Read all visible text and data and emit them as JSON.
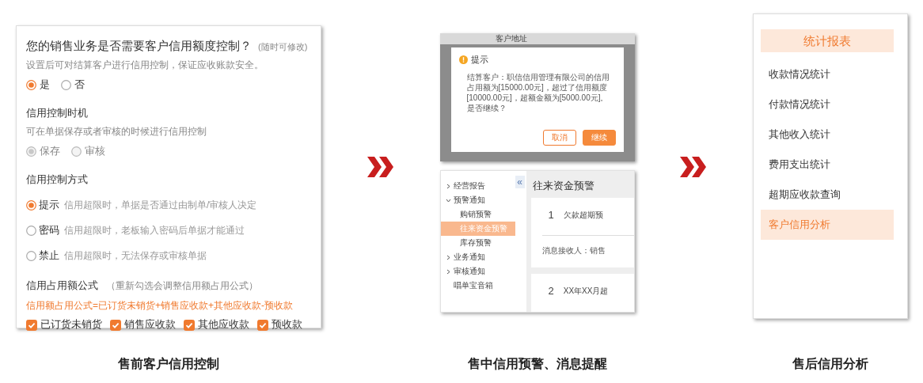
{
  "credit_settings": {
    "question": "您的销售业务是否需要客户信用额度控制？",
    "question_note": "(随时可修改)",
    "description": "设置后可对结算客户进行信用控制，保证应收账款安全。",
    "enable_options": [
      {
        "label": "是",
        "selected": true
      },
      {
        "label": "否",
        "selected": false
      }
    ],
    "timing": {
      "title": "信用控制时机",
      "description": "可在单据保存或者审核的时候进行信用控制",
      "options": [
        {
          "label": "保存",
          "selected": true,
          "disabled": true
        },
        {
          "label": "审核",
          "selected": false,
          "disabled": true
        }
      ]
    },
    "method": {
      "title": "信用控制方式",
      "options": [
        {
          "label": "提示",
          "description": "信用超限时，单据是否通过由制单/审核人决定",
          "selected": true
        },
        {
          "label": "密码",
          "description": "信用超限时，老板输入密码后单据才能通过",
          "selected": false
        },
        {
          "label": "禁止",
          "description": "信用超限时，无法保存或审核单据",
          "selected": false
        }
      ]
    },
    "formula": {
      "title": "信用占用额公式",
      "note": "（重新勾选会调整信用额占用公式）",
      "expression": "信用额占用公式=已订货未销货+销售应收款+其他应收款-预收款",
      "items": [
        {
          "label": "已订货未销货",
          "checked": true
        },
        {
          "label": "销售应收款",
          "checked": true
        },
        {
          "label": "其他应收款",
          "checked": true
        },
        {
          "label": "预收款",
          "checked": true
        }
      ]
    }
  },
  "credit_alert_dialog": {
    "window_title": "客户地址",
    "title": "提示",
    "message": "结算客户：职信信用管理有限公司的信用占用额为[15000.00元]，超过了信用额度[10000.00元]，超额金额为[5000.00元]。是否继续？",
    "buttons": [
      {
        "label": "取消",
        "kind": "secondary"
      },
      {
        "label": "继续",
        "kind": "primary"
      }
    ]
  },
  "notification_tree": {
    "items": [
      {
        "label": "经营报告",
        "kind": "group",
        "expanded": false,
        "selected": false
      },
      {
        "label": "预警通知",
        "kind": "group",
        "expanded": true,
        "selected": false,
        "children": [
          {
            "label": "购销预警",
            "kind": "leaf",
            "selected": false
          },
          {
            "label": "往来资金预警",
            "kind": "leaf",
            "selected": true
          },
          {
            "label": "库存预警",
            "kind": "leaf",
            "selected": false
          }
        ]
      },
      {
        "label": "业务通知",
        "kind": "group",
        "expanded": false,
        "selected": false
      },
      {
        "label": "审核通知",
        "kind": "group",
        "expanded": false,
        "selected": false
      },
      {
        "label": "唱单宝音箱",
        "kind": "leaf",
        "selected": false
      }
    ]
  },
  "alert_panel": {
    "collapse_button": "«",
    "title": "往来资金预警",
    "cards": [
      {
        "number": "1",
        "title": "欠款超期预",
        "recipient": "消息接收人：销售"
      },
      {
        "number": "2",
        "title": "XX年XX月超"
      }
    ]
  },
  "reports_menu": {
    "title": "统计报表",
    "items": [
      {
        "label": "收款情况统计",
        "selected": false
      },
      {
        "label": "付款情况统计",
        "selected": false
      },
      {
        "label": "其他收入统计",
        "selected": false
      },
      {
        "label": "费用支出统计",
        "selected": false
      },
      {
        "label": "超期应收款查询",
        "selected": false
      },
      {
        "label": "客户信用分析",
        "selected": true
      }
    ]
  },
  "captions": [
    "售前客户信用控制",
    "售中信用预警、消息提醒",
    "售后信用分析"
  ]
}
